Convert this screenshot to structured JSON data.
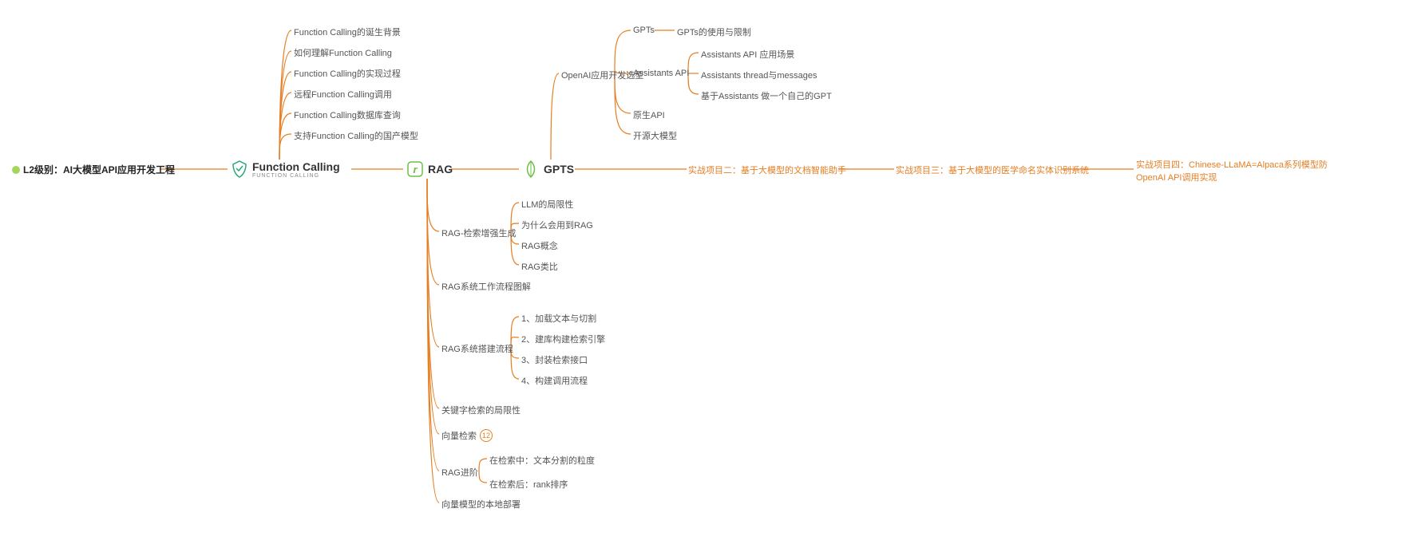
{
  "root": {
    "label": "L2级别：AI大模型API应用开发工程"
  },
  "func_calling": {
    "title": "Function Calling",
    "subtitle": "FUNCTION CALLING",
    "children": [
      "Function Calling的诞生背景",
      "如何理解Function Calling",
      "Function Calling的实现过程",
      "远程Function Calling调用",
      "Function Calling数据库查询",
      "支持Function Calling的国产模型"
    ]
  },
  "rag": {
    "title": "RAG",
    "children": {
      "search_gen": {
        "label": "RAG-检索增强生成",
        "items": [
          "LLM的局限性",
          "为什么会用到RAG",
          "RAG概念",
          "RAG类比"
        ]
      },
      "workflow": "RAG系统工作流程图解",
      "build": {
        "label": "RAG系统搭建流程",
        "items": [
          "1、加载文本与切割",
          "2、建库构建检索引擎",
          "3、封装检索接口",
          "4、构建调用流程"
        ]
      },
      "keyword_limit": "关键字检索的局限性",
      "vector_search": {
        "label": "向量检索",
        "badge": "12"
      },
      "advanced": {
        "label": "RAG进阶",
        "items": [
          "在检索中：文本分割的粒度",
          "在检索后：rank排序"
        ]
      },
      "local_deploy": "向量模型的本地部署"
    }
  },
  "gpts": {
    "title": "GPTS",
    "openai_select": {
      "label": "OpenAI应用开发选型",
      "gpts_node": {
        "label": "GPTs",
        "child": "GPTs的使用与限制"
      },
      "assistants": {
        "label": "Assistants API",
        "items": [
          "Assistants API 应用场景",
          "Assistants thread与messages",
          "基于Assistants 做一个自己的GPT"
        ]
      },
      "native_api": "原生API",
      "open_model": "开源大模型"
    }
  },
  "projects": {
    "p2": "实战项目二：基于大模型的文档智能助手",
    "p3": "实战项目三：基于大模型的医学命名实体识别系统",
    "p4_line1": "实战项目四：Chinese-LLaMA=Alpaca系列模型防",
    "p4_line2": "OpenAI API调用实现"
  }
}
